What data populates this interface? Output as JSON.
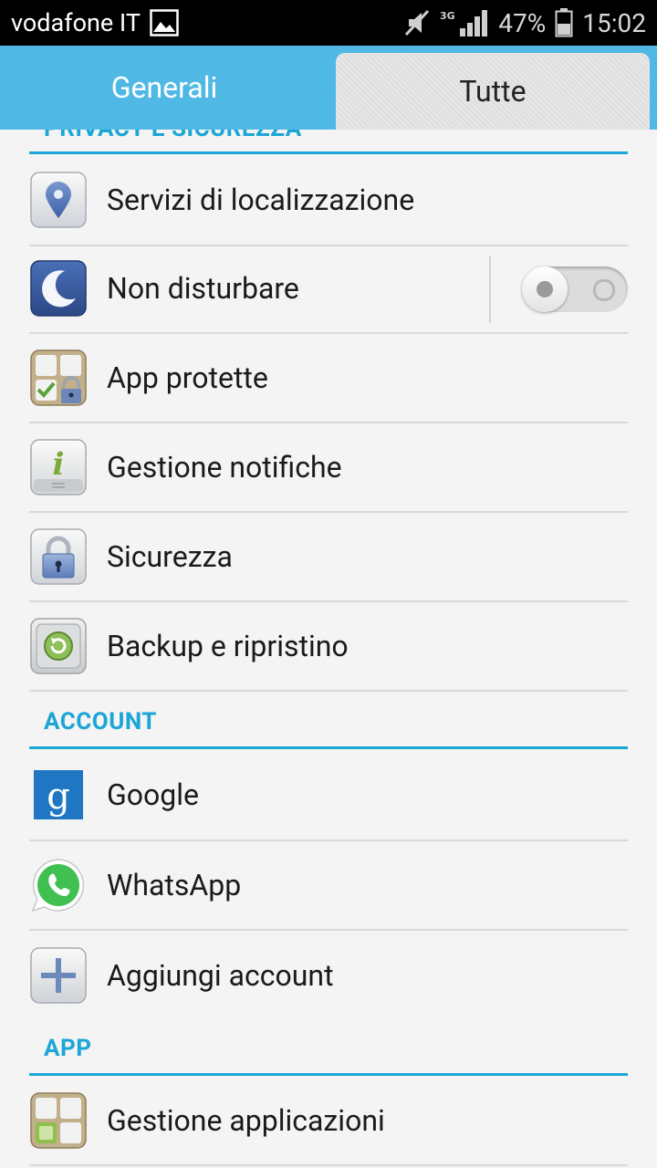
{
  "status_bar": {
    "carrier": "vodafone IT",
    "network": "3G",
    "battery": "47%",
    "time": "15:02",
    "icons": [
      "gallery-icon",
      "mute-icon",
      "signal-icon",
      "battery-icon"
    ]
  },
  "tabs": [
    {
      "label": "Generali",
      "selected": false
    },
    {
      "label": "Tutte",
      "selected": true
    }
  ],
  "sections": {
    "privacy": {
      "title": "PRIVACY E SICUREZZA"
    },
    "account": {
      "title": "ACCOUNT"
    },
    "app": {
      "title": "APP"
    }
  },
  "items": {
    "location": {
      "label": "Servizi di localizzazione",
      "icon": "location-pin-icon"
    },
    "dnd": {
      "label": "Non disturbare",
      "icon": "moon-icon",
      "toggle_on": false
    },
    "protected": {
      "label": "App protette",
      "icon": "protected-apps-icon"
    },
    "notifications": {
      "label": "Gestione notifiche",
      "icon": "info-icon"
    },
    "security": {
      "label": "Sicurezza",
      "icon": "padlock-icon"
    },
    "backup": {
      "label": "Backup e ripristino",
      "icon": "backup-icon"
    },
    "google": {
      "label": "Google",
      "icon": "google-icon"
    },
    "whatsapp": {
      "label": "WhatsApp",
      "icon": "whatsapp-icon"
    },
    "add_account": {
      "label": "Aggiungi account",
      "icon": "plus-icon"
    },
    "app_manager": {
      "label": "Gestione applicazioni",
      "icon": "app-manager-icon"
    }
  },
  "colors": {
    "accent": "#1ba6d6",
    "tabbar": "#4fb8e5"
  }
}
